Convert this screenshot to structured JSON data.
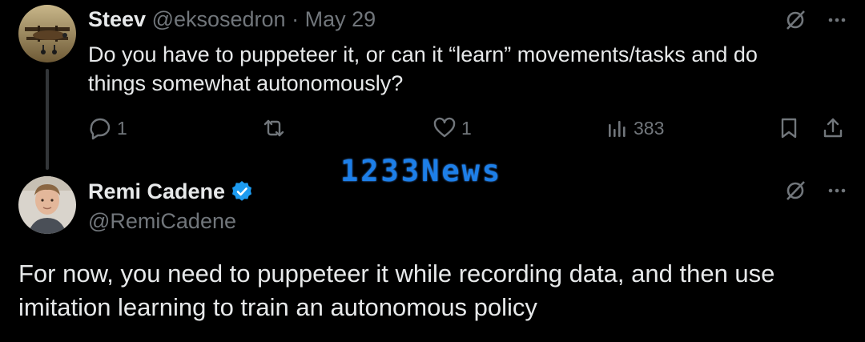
{
  "tweet1": {
    "name": "Steev",
    "handle": "@eksosedron",
    "separator": "·",
    "date": "May 29",
    "text": "Do you have to puppeteer it, or can it “learn” movements/tasks and do things somewhat autonomously?",
    "replies": "1",
    "likes": "1",
    "views": "383",
    "avatar_icon": "biplane-avatar"
  },
  "tweet2": {
    "name": "Remi Cadene",
    "handle": "@RemiCadene",
    "verified": true,
    "text": "For now, you need to puppeteer it while recording data, and then use imitation learning to train an autonomous policy",
    "avatar_icon": "person-avatar"
  },
  "watermark": "1233News",
  "colors": {
    "background": "#000000",
    "text": "#e7e9ea",
    "muted": "#71767b",
    "verified_blue": "#1d9bf0",
    "watermark_blue": "#1d7fe8"
  }
}
